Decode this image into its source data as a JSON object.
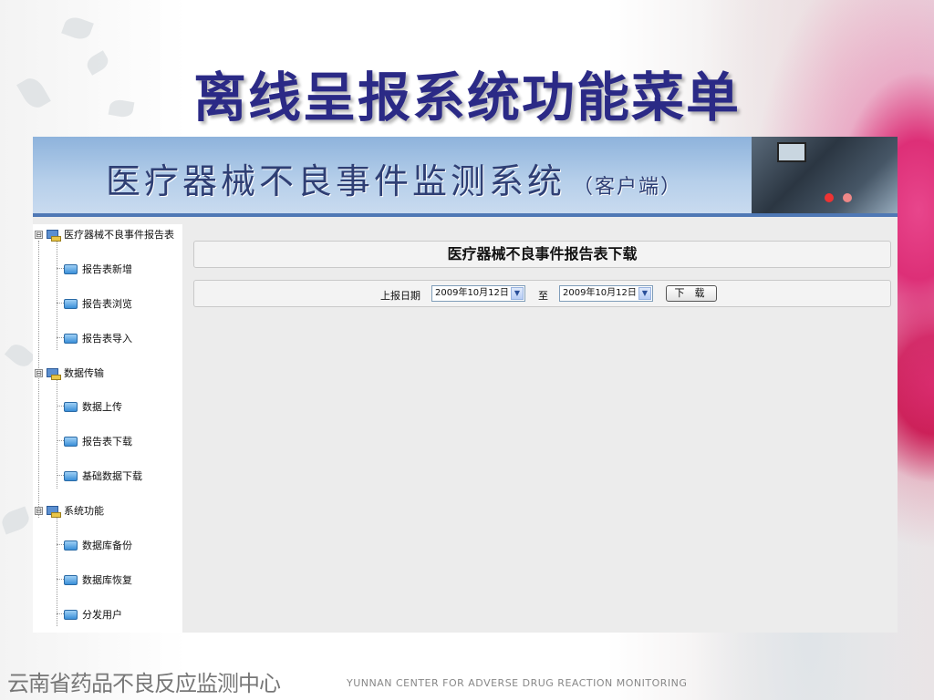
{
  "slide": {
    "title": "离线呈报系统功能菜单",
    "footer_cn": "云南省药品不良反应监测中心",
    "footer_en": "YUNNAN CENTER FOR ADVERSE DRUG REACTION MONITORING"
  },
  "app": {
    "banner_title": "医疗器械不良事件监测系统",
    "banner_subtitle": "（客户端）",
    "tree": [
      {
        "label": "医疗器械不良事件报告表",
        "toggle": "⊟",
        "icon": "computer-icon",
        "children": [
          {
            "label": "报告表新增",
            "icon": "folder-icon"
          },
          {
            "label": "报告表浏览",
            "icon": "folder-icon"
          },
          {
            "label": "报告表导入",
            "icon": "folder-icon"
          }
        ]
      },
      {
        "label": "数据传输",
        "toggle": "⊟",
        "icon": "computer-icon",
        "children": [
          {
            "label": "数据上传",
            "icon": "folder-icon"
          },
          {
            "label": "报告表下载",
            "icon": "folder-icon"
          },
          {
            "label": "基础数据下载",
            "icon": "folder-icon"
          }
        ]
      },
      {
        "label": "系统功能",
        "toggle": "⊟",
        "icon": "computer-icon",
        "children": [
          {
            "label": "数据库备份",
            "icon": "folder-icon"
          },
          {
            "label": "数据库恢复",
            "icon": "folder-icon"
          },
          {
            "label": "分发用户",
            "icon": "folder-icon"
          }
        ]
      }
    ],
    "main": {
      "panel_title": "医疗器械不良事件报告表下载",
      "date_label": "上报日期",
      "date_from": "2009年10月12日",
      "to_label": "至",
      "date_to": "2009年10月12日",
      "download_button": "下 载",
      "dropdown_icon": "chevron-down-icon"
    }
  },
  "colors": {
    "title": "#2b2a86",
    "banner_text": "#2f3f74",
    "banner_accent": "#4f78b5"
  }
}
